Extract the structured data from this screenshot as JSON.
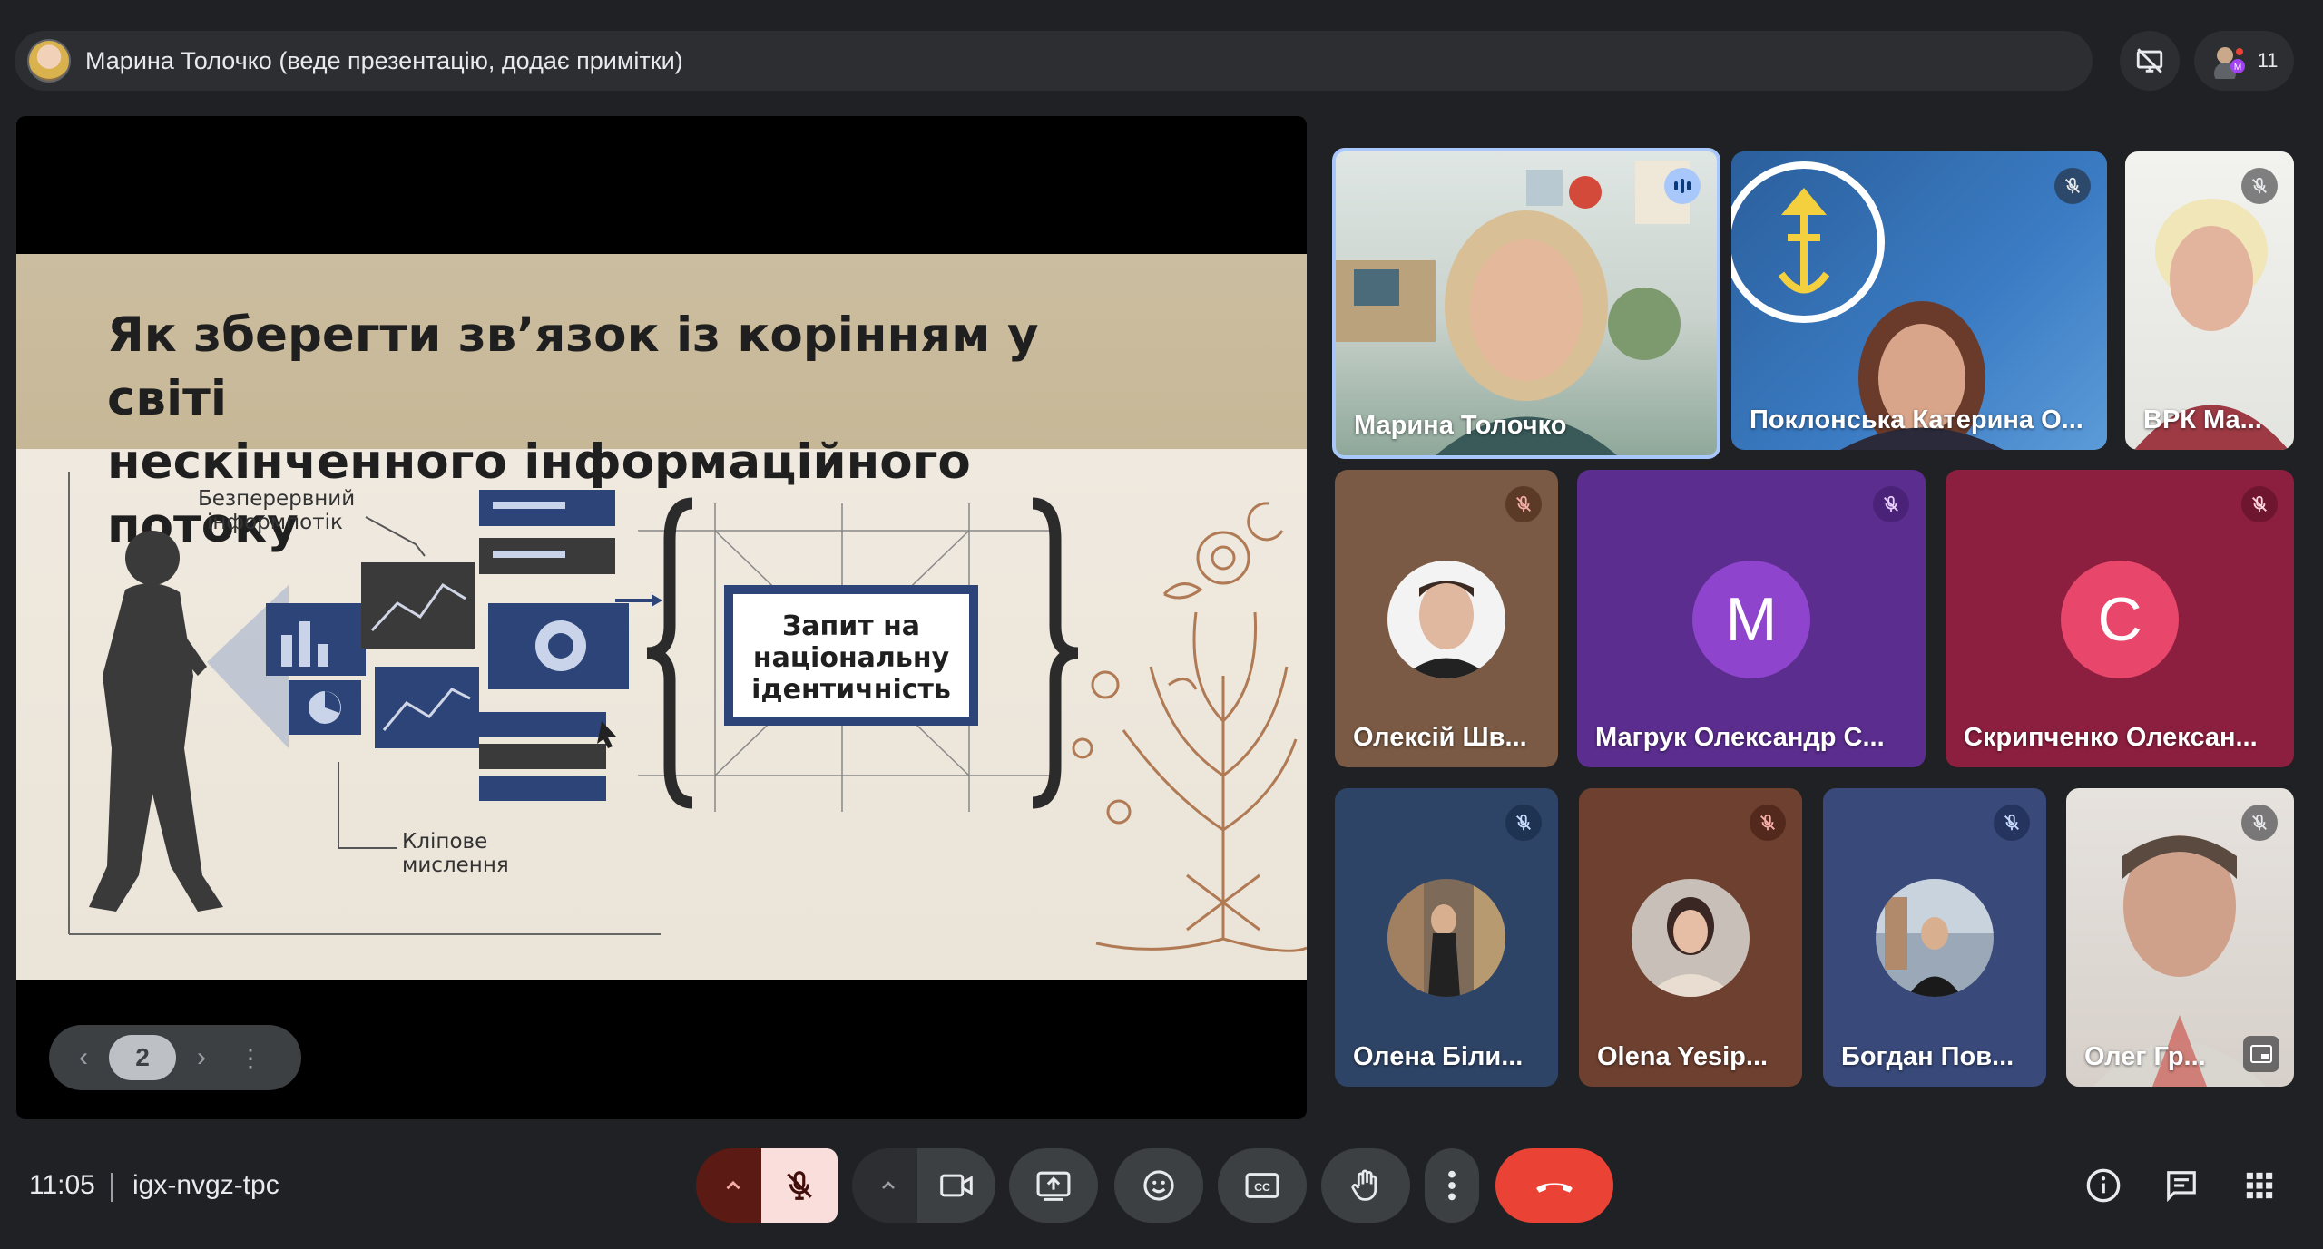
{
  "presenter_bar": {
    "text": "Марина Толочко (веде презентацію, додає примітки)"
  },
  "participant_count": "11",
  "slide": {
    "title_line1": "Як зберегти зв’язок із корінням у світі",
    "title_line2": "нескінченного інформаційного потоку",
    "label_infostream_1": "Безперервний",
    "label_infostream_2": "інформпотік",
    "label_clip_1": "Кліпове",
    "label_clip_2": "мислення",
    "box_line1": "Запит на",
    "box_line2": "національну",
    "box_line3": "ідентичність"
  },
  "pager": {
    "page": "2",
    "prev_icon": "chevron-left-icon",
    "next_icon": "chevron-right-icon"
  },
  "participants": [
    {
      "name": "Марина Толочко",
      "state": "speaking"
    },
    {
      "name": "Поклонська Катерина О...",
      "state": "muted"
    },
    {
      "name": "ВРК Ма...",
      "state": "muted"
    },
    {
      "name": "Олексій Шв...",
      "state": "muted"
    },
    {
      "name": "Магрук Олександр С...",
      "initial": "М",
      "state": "muted"
    },
    {
      "name": "Скрипченко Олексан...",
      "initial": "С",
      "state": "muted"
    },
    {
      "name": "Олена Біли...",
      "state": "muted"
    },
    {
      "name": "Olena Yesip...",
      "state": "muted"
    },
    {
      "name": "Богдан Пов...",
      "state": "muted"
    },
    {
      "name": "Олег Гр...",
      "state": "muted"
    }
  ],
  "footer": {
    "time": "11:05",
    "meeting_code": "igx-nvgz-tpc"
  },
  "colors": {
    "end_call": "#ea4335",
    "mic_off": "#f9dedc",
    "muted_caret": "#5c1a14",
    "speaking_border": "#a8c7fa"
  }
}
